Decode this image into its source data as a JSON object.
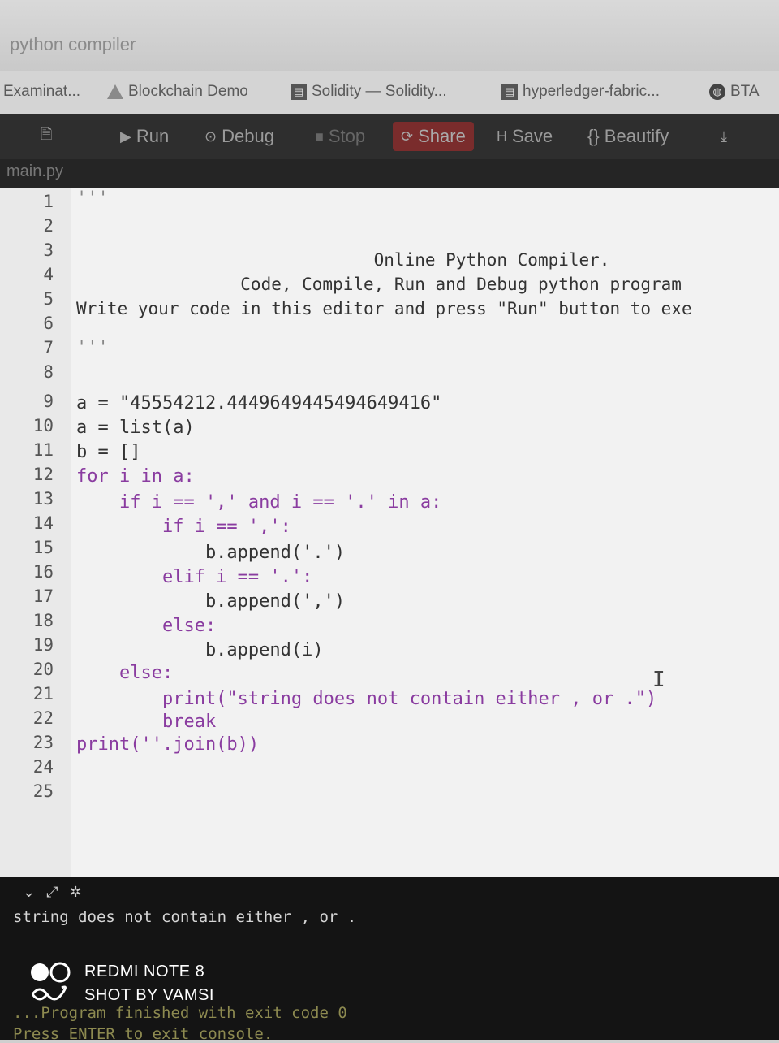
{
  "browser": {
    "tab_title": "python compiler",
    "bookmarks": [
      {
        "label": "Examinat...",
        "icon": "none"
      },
      {
        "label": "Blockchain Demo",
        "icon": "triangle-icon"
      },
      {
        "label": "Solidity — Solidity...",
        "icon": "document-icon"
      },
      {
        "label": "hyperledger-fabric...",
        "icon": "document-icon"
      },
      {
        "label": "BTA",
        "icon": "globe-icon"
      }
    ]
  },
  "toolbar": {
    "run_label": "Run",
    "debug_label": "Debug",
    "stop_label": "Stop",
    "share_label": "Share",
    "save_label": "Save",
    "beautify_label": "{} Beautify",
    "download_icon": "download-icon",
    "file_icon": "file-icon"
  },
  "file_tab": {
    "label": "main.py"
  },
  "editor": {
    "line_numbers": [
      "1",
      "2",
      "3",
      "4",
      "5",
      "6",
      "7",
      "8",
      "9",
      "10",
      "11",
      "12",
      "13",
      "14",
      "15",
      "16",
      "17",
      "18",
      "19",
      "20",
      "21",
      "22",
      "23",
      "24",
      "25"
    ],
    "lines": [
      "'''",
      "",
      "                             Online Python Compiler.",
      "                Code, Compile, Run and Debug python program",
      "Write your code in this editor and press \"Run\" button to exe",
      "",
      "'''",
      "",
      "a = \"45554212.4449649445494649416\"",
      "a = list(a)",
      "b = []",
      "for i in a:",
      "    if i == ',' and i == '.' in a:",
      "        if i == ',':",
      "            b.append('.')",
      "        elif i == '.':",
      "            b.append(',')",
      "        else:",
      "            b.append(i)",
      "    else:",
      "        print(\"string does not contain either , or .\")",
      "        break",
      "print(''.join(b))",
      "",
      ""
    ]
  },
  "output": {
    "result": "string does not contain either , or .",
    "finished": "...Program finished with exit code 0",
    "press_enter": "Press ENTER to exit console."
  },
  "watermark": {
    "line1": "REDMI NOTE 8",
    "line2": "SHOT BY VAMSI"
  }
}
